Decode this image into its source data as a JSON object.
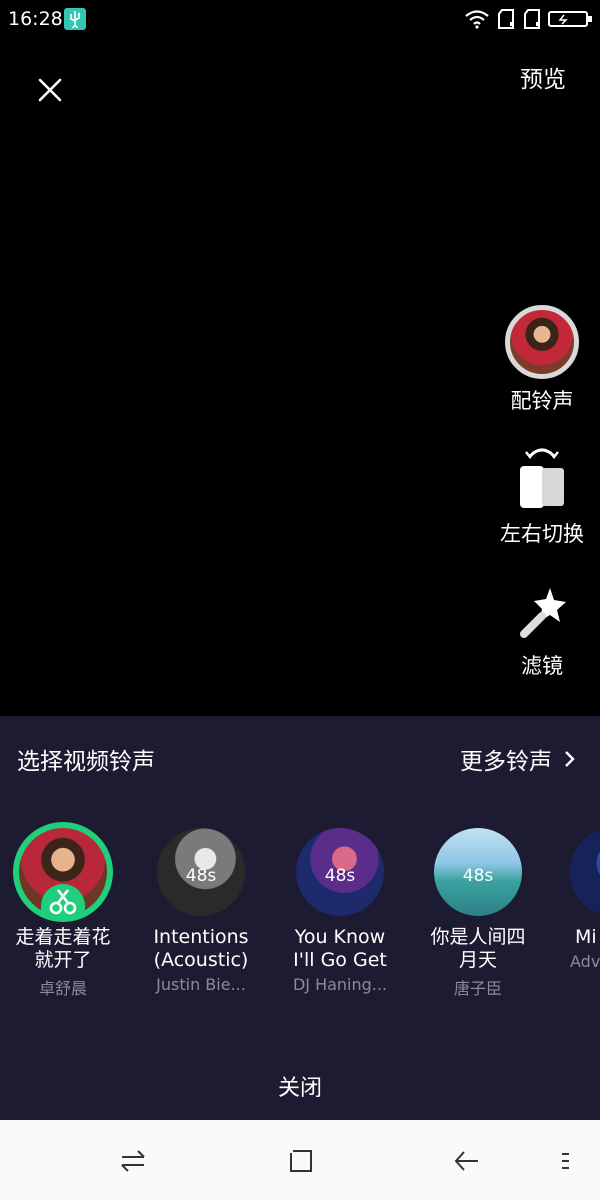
{
  "status_bar": {
    "time": "16:28",
    "icons": [
      "usb-icon",
      "wifi-icon",
      "sim1-icon",
      "sim2-icon",
      "battery-icon"
    ]
  },
  "top": {
    "close_icon": "close-icon",
    "preview_label": "预览"
  },
  "tools": {
    "ringtone_label": "配铃声",
    "swap_label": "左右切换",
    "filter_label": "滤镜"
  },
  "sheet": {
    "title": "选择视频铃声",
    "more_label": "更多铃声",
    "close_label": "关闭",
    "songs": [
      {
        "title_line1": "走着走着花",
        "title_line2": "就开了",
        "artist": "卓舒晨",
        "duration": "",
        "selected": true
      },
      {
        "title_line1": "Intentions",
        "title_line2": "(Acoustic)",
        "artist": "Justin Bie...",
        "duration": "48s",
        "selected": false
      },
      {
        "title_line1": "You Know",
        "title_line2": "I'll Go Get",
        "artist": "DJ Haning...",
        "duration": "48s",
        "selected": false
      },
      {
        "title_line1": "你是人间四",
        "title_line2": "月天",
        "artist": "唐子臣",
        "duration": "48s",
        "selected": false
      },
      {
        "title_line1": "Mi",
        "title_line2": "",
        "artist": "Adv",
        "duration": "",
        "selected": false
      }
    ]
  },
  "nav_bar": {
    "icons": [
      "switch-app-icon",
      "home-icon",
      "back-icon",
      "menu-icon"
    ]
  },
  "colors": {
    "sheet_bg": "#1d1b31",
    "accent_green": "#1fcf7b",
    "artist_text": "#8a8a9c"
  }
}
